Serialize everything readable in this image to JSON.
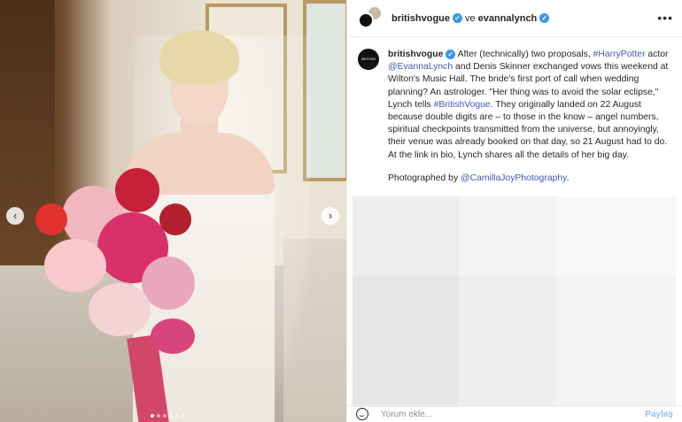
{
  "header": {
    "account_primary": "britishvogue",
    "conjunction": "ve",
    "account_secondary": "evannalynch",
    "avatar_text": "BRITISH VOGUE"
  },
  "caption": {
    "username": "britishvogue",
    "avatar_text": "BRITISH VOGUE",
    "segments": [
      {
        "text": "After (technically) two proposals, ",
        "kind": "text"
      },
      {
        "text": "#HarryPotter",
        "kind": "tag"
      },
      {
        "text": " actor ",
        "kind": "text"
      },
      {
        "text": "@EvannaLynch",
        "kind": "tag"
      },
      {
        "text": " and Denis Skinner exchanged vows this weekend at Wilton's Music Hall. The bride's first port of call when wedding planning? An astrologer. \"Her thing was to avoid the solar eclipse,\" Lynch tells ",
        "kind": "text"
      },
      {
        "text": "#BritishVogue",
        "kind": "tag"
      },
      {
        "text": ". They originally landed on 22 August because double digits are – to those in the know – angel numbers, spiritual checkpoints transmitted from the universe, but annoyingly, their venue was already booked on that day, so 21 August had to do. At the link in bio, Lynch shares all the details of her big day.",
        "kind": "text"
      }
    ],
    "photo_credit_prefix": "Photographed by ",
    "photo_credit_tag": "@CamillaJoyPhotography",
    "photo_credit_suffix": "."
  },
  "footer": {
    "comment_placeholder": "Yorum ekle...",
    "post_label": "Paylaş"
  },
  "icons": {
    "verified": "verified-badge-icon",
    "more": "more-options-icon",
    "emoji": "emoji-icon",
    "prev": "chevron-left-icon",
    "next": "chevron-right-icon"
  },
  "carousel": {
    "prev_glyph": "‹",
    "next_glyph": "›",
    "slide_count": 6,
    "active_slide": 1
  },
  "colors": {
    "verified": "#3897f0",
    "link": "#3a5cb8",
    "post_button": "#8ec0f0"
  }
}
